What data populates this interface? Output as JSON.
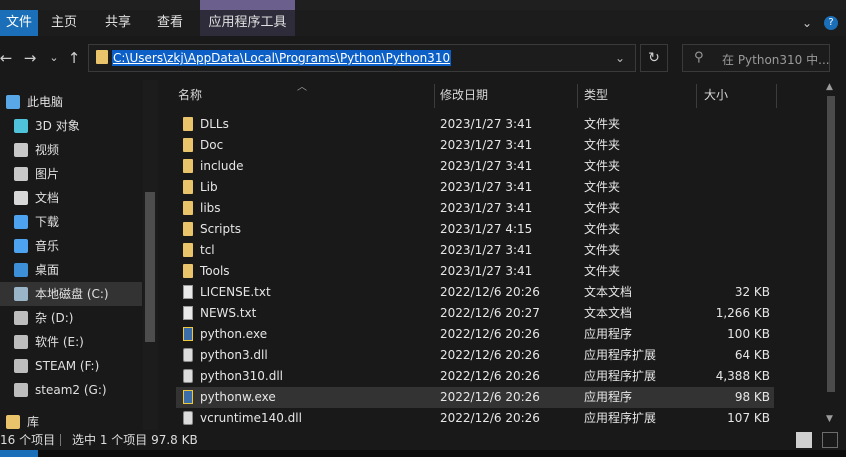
{
  "ribbon": {
    "tabs": [
      "文件",
      "主页",
      "共享",
      "查看"
    ],
    "context_tab": "应用程序工具",
    "minimize_glyph": "⌄",
    "help_glyph": "?"
  },
  "nav": {
    "back": "←",
    "forward": "→",
    "recent": "⌄",
    "up": "↑",
    "address": "C:\\Users\\zkj\\AppData\\Local\\Programs\\Python\\Python310",
    "address_dropdown": "⌄",
    "refresh": "↻",
    "search_placeholder": "在 Python310 中..."
  },
  "sidebar": {
    "items": [
      {
        "label": "此电脑",
        "icon": "computer-icon",
        "color": "#5aa7e8"
      },
      {
        "label": "3D 对象",
        "icon": "cube-icon",
        "color": "#4fc3d9"
      },
      {
        "label": "视频",
        "icon": "video-icon",
        "color": "#c8c8c8"
      },
      {
        "label": "图片",
        "icon": "pictures-icon",
        "color": "#c8c8c8"
      },
      {
        "label": "文档",
        "icon": "documents-icon",
        "color": "#d8d8d8"
      },
      {
        "label": "下载",
        "icon": "download-icon",
        "color": "#4da3f0"
      },
      {
        "label": "音乐",
        "icon": "music-icon",
        "color": "#4da3f0"
      },
      {
        "label": "桌面",
        "icon": "desktop-icon",
        "color": "#3d8fd8"
      },
      {
        "label": "本地磁盘 (C:)",
        "icon": "drive-icon",
        "color": "#9ab4c8",
        "selected": true
      },
      {
        "label": "杂 (D:)",
        "icon": "drive-icon",
        "color": "#bdbdbd"
      },
      {
        "label": "软件 (E:)",
        "icon": "drive-icon",
        "color": "#bdbdbd"
      },
      {
        "label": "STEAM (F:)",
        "icon": "drive-icon",
        "color": "#bdbdbd"
      },
      {
        "label": "steam2 (G:)",
        "icon": "drive-icon",
        "color": "#bdbdbd"
      },
      {
        "label": "库",
        "icon": "library-icon",
        "color": "#e9c46a"
      }
    ]
  },
  "columns": {
    "name": "名称",
    "modified": "修改日期",
    "type": "类型",
    "size": "大小"
  },
  "files": [
    {
      "name": "DLLs",
      "modified": "2023/1/27 3:41",
      "type": "文件夹",
      "size": "",
      "kind": "folder"
    },
    {
      "name": "Doc",
      "modified": "2023/1/27 3:41",
      "type": "文件夹",
      "size": "",
      "kind": "folder"
    },
    {
      "name": "include",
      "modified": "2023/1/27 3:41",
      "type": "文件夹",
      "size": "",
      "kind": "folder"
    },
    {
      "name": "Lib",
      "modified": "2023/1/27 3:41",
      "type": "文件夹",
      "size": "",
      "kind": "folder"
    },
    {
      "name": "libs",
      "modified": "2023/1/27 3:41",
      "type": "文件夹",
      "size": "",
      "kind": "folder"
    },
    {
      "name": "Scripts",
      "modified": "2023/1/27 4:15",
      "type": "文件夹",
      "size": "",
      "kind": "folder"
    },
    {
      "name": "tcl",
      "modified": "2023/1/27 3:41",
      "type": "文件夹",
      "size": "",
      "kind": "folder"
    },
    {
      "name": "Tools",
      "modified": "2023/1/27 3:41",
      "type": "文件夹",
      "size": "",
      "kind": "folder"
    },
    {
      "name": "LICENSE.txt",
      "modified": "2022/12/6 20:26",
      "type": "文本文档",
      "size": "32 KB",
      "kind": "doc"
    },
    {
      "name": "NEWS.txt",
      "modified": "2022/12/6 20:27",
      "type": "文本文档",
      "size": "1,266 KB",
      "kind": "doc"
    },
    {
      "name": "python.exe",
      "modified": "2022/12/6 20:26",
      "type": "应用程序",
      "size": "100 KB",
      "kind": "exe"
    },
    {
      "name": "python3.dll",
      "modified": "2022/12/6 20:26",
      "type": "应用程序扩展",
      "size": "64 KB",
      "kind": "dll"
    },
    {
      "name": "python310.dll",
      "modified": "2022/12/6 20:26",
      "type": "应用程序扩展",
      "size": "4,388 KB",
      "kind": "dll"
    },
    {
      "name": "pythonw.exe",
      "modified": "2022/12/6 20:26",
      "type": "应用程序",
      "size": "98 KB",
      "kind": "exe",
      "selected": true
    },
    {
      "name": "vcruntime140.dll",
      "modified": "2022/12/6 20:26",
      "type": "应用程序扩展",
      "size": "107 KB",
      "kind": "dll"
    }
  ],
  "status": {
    "count": "16 个项目",
    "selection": "选中 1 个项目  97.8 KB"
  }
}
